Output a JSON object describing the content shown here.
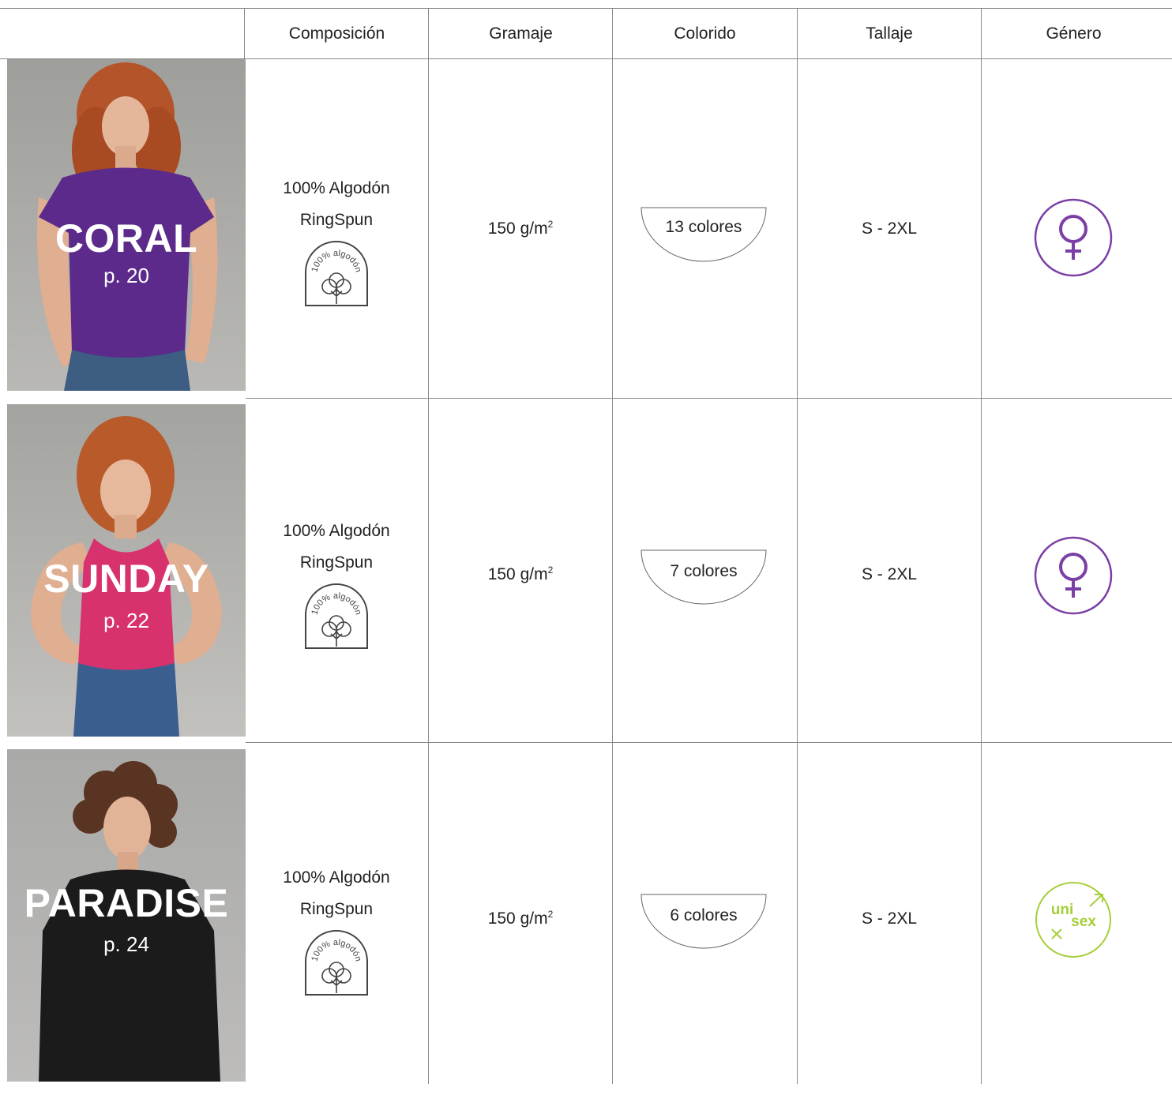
{
  "headers": {
    "composicion": "Composición",
    "gramaje": "Gramaje",
    "colorido": "Colorido",
    "tallaje": "Tallaje",
    "genero": "Género"
  },
  "products": [
    {
      "name": "CORAL",
      "page": "p. 20",
      "shirt_color": "#5b2a8a",
      "composition_1": "100% Algodón",
      "composition_2": "RingSpun",
      "badge_text": "100% algodón",
      "weight": "150 g/m",
      "weight_exp": "2",
      "colors": "13 colores",
      "sizes": "S - 2XL",
      "gender": "female",
      "gender_icon": "female-symbol-icon",
      "gender_color": "#7b3fa6"
    },
    {
      "name": "SUNDAY",
      "page": "p. 22",
      "shirt_color": "#d8326e",
      "composition_1": "100% Algodón",
      "composition_2": "RingSpun",
      "badge_text": "100% algodón",
      "weight": "150 g/m",
      "weight_exp": "2",
      "colors": "7 colores",
      "sizes": "S - 2XL",
      "gender": "female",
      "gender_icon": "female-symbol-icon",
      "gender_color": "#7b3fa6"
    },
    {
      "name": "PARADISE",
      "page": "p. 24",
      "shirt_color": "#1b1b1b",
      "composition_1": "100% Algodón",
      "composition_2": "RingSpun",
      "badge_text": "100% algodón",
      "weight": "150 g/m",
      "weight_exp": "2",
      "colors": "6 colores",
      "sizes": "S - 2XL",
      "gender": "unisex",
      "gender_icon": "unisex-icon",
      "gender_label_1": "uni",
      "gender_label_2": "sex",
      "gender_color": "#a6cf3a"
    }
  ]
}
